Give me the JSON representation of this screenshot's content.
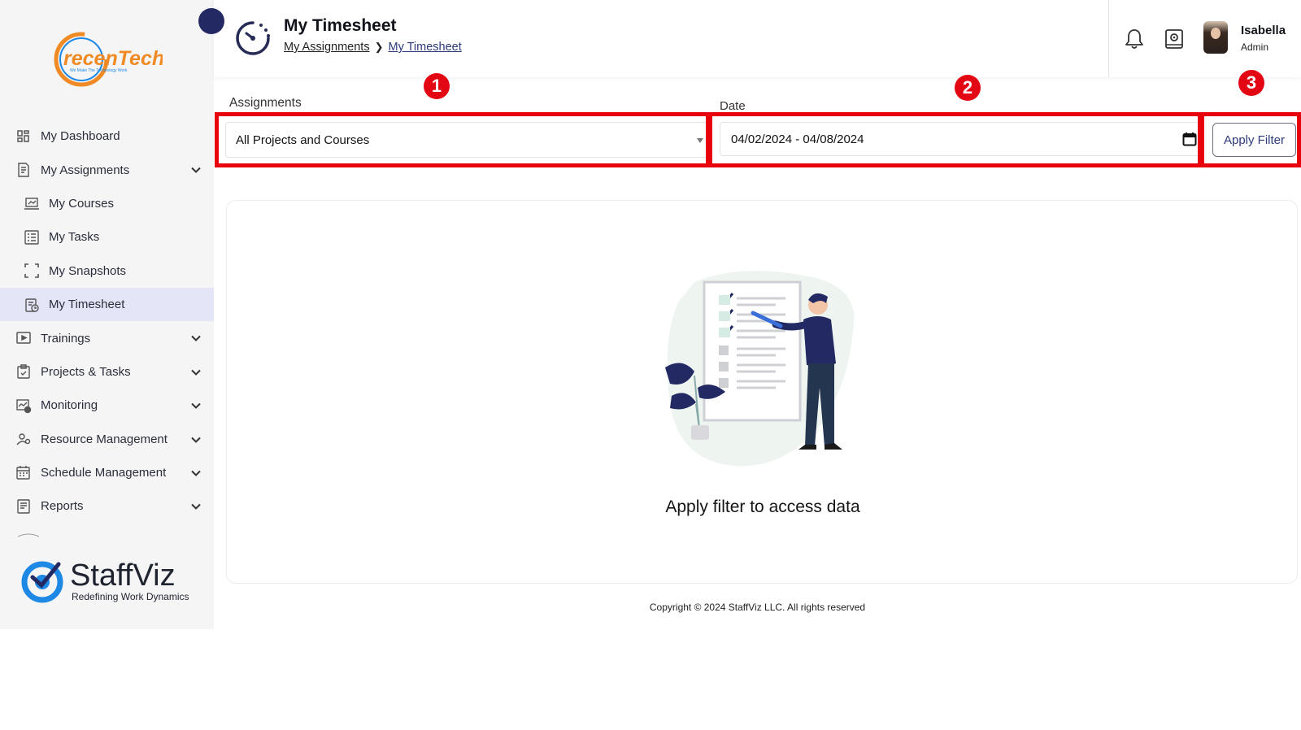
{
  "brand": {
    "company_logo_text": "recenTech",
    "company_tagline": "We Make The Technology Work",
    "product_name": "StaffViz",
    "product_tagline": "Redefining Work Dynamics"
  },
  "sidebar": {
    "items": [
      {
        "label": "My Dashboard",
        "icon": "dashboard-icon"
      },
      {
        "label": "My Assignments",
        "icon": "assignments-icon",
        "expandable": true,
        "expanded": true
      },
      {
        "label": "My Courses",
        "icon": "courses-icon",
        "sub": true
      },
      {
        "label": "My Tasks",
        "icon": "tasks-icon",
        "sub": true
      },
      {
        "label": "My Snapshots",
        "icon": "snapshots-icon",
        "sub": true
      },
      {
        "label": "My Timesheet",
        "icon": "timesheet-icon",
        "sub": true,
        "active": true
      },
      {
        "label": "Trainings",
        "icon": "trainings-icon",
        "expandable": true
      },
      {
        "label": "Projects & Tasks",
        "icon": "projects-icon",
        "expandable": true
      },
      {
        "label": "Monitoring",
        "icon": "monitoring-icon",
        "expandable": true
      },
      {
        "label": "Resource Management",
        "icon": "resource-icon",
        "expandable": true
      },
      {
        "label": "Schedule Management",
        "icon": "schedule-icon",
        "expandable": true
      },
      {
        "label": "Reports",
        "icon": "reports-icon",
        "expandable": true
      }
    ]
  },
  "header": {
    "title": "My Timesheet",
    "breadcrumb": [
      "My Assignments",
      "My Timesheet"
    ],
    "user": {
      "name": "Isabella",
      "role": "Admin"
    }
  },
  "filters": {
    "assignments_label": "Assignments",
    "assignments_value": "All Projects and Courses",
    "date_label": "Date",
    "date_value": "04/02/2024 - 04/08/2024",
    "apply_label": "Apply Filter"
  },
  "annotations": [
    "1",
    "2",
    "3"
  ],
  "content": {
    "empty_message": "Apply filter to access data"
  },
  "footer": {
    "copyright": "Copyright © 2024 StaffViz LLC. All rights reserved"
  },
  "colors": {
    "accent_navy": "#232a63",
    "active_bg": "#e4e6f7",
    "highlight_red": "#e8000b",
    "brand_orange": "#f08a24",
    "brand_blue": "#1e88e5"
  }
}
